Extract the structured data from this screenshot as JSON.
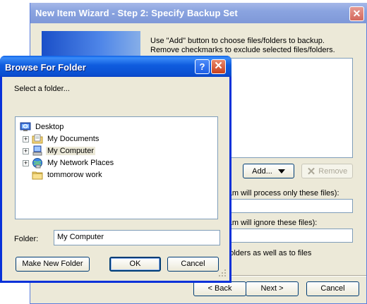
{
  "wizard": {
    "title": "New Item Wizard - Step 2: Specify Backup Set",
    "instruction_line1": "Use \"Add\" button to choose files/folders to backup.",
    "instruction_line2": "Remove checkmarks to exclude selected files/folders.",
    "add_label": "Add...",
    "remove_label": "Remove",
    "include_label": "gram will process only these files):",
    "exclude_label": "gram will ignore these files):",
    "apply_label": "o folders as well as to files",
    "back_label": "< Back",
    "next_label": "Next >",
    "cancel_label": "Cancel",
    "close_glyph": "✕"
  },
  "browse": {
    "title": "Browse For Folder",
    "help_glyph": "?",
    "close_glyph": "✕",
    "prompt": "Select a folder...",
    "folder_label": "Folder:",
    "folder_value": "My Computer",
    "new_folder_label": "Make New Folder",
    "ok_label": "OK",
    "cancel_label": "Cancel",
    "tree": [
      {
        "label": "Desktop",
        "icon": "desktop-icon",
        "expander": false,
        "selected": false
      },
      {
        "label": "My Documents",
        "icon": "documents-folder-icon",
        "expander": true,
        "selected": false
      },
      {
        "label": "My Computer",
        "icon": "computer-icon",
        "expander": true,
        "selected": true
      },
      {
        "label": "My Network Places",
        "icon": "network-places-icon",
        "expander": true,
        "selected": false
      },
      {
        "label": "tommorow work",
        "icon": "folder-icon",
        "expander": false,
        "selected": false
      }
    ]
  },
  "colors": {
    "titlebar_active": "#0a4fd0",
    "titlebar_inactive": "#8aa4e0",
    "dialog_face": "#ece9d8",
    "border_blue": "#7f9db9"
  }
}
